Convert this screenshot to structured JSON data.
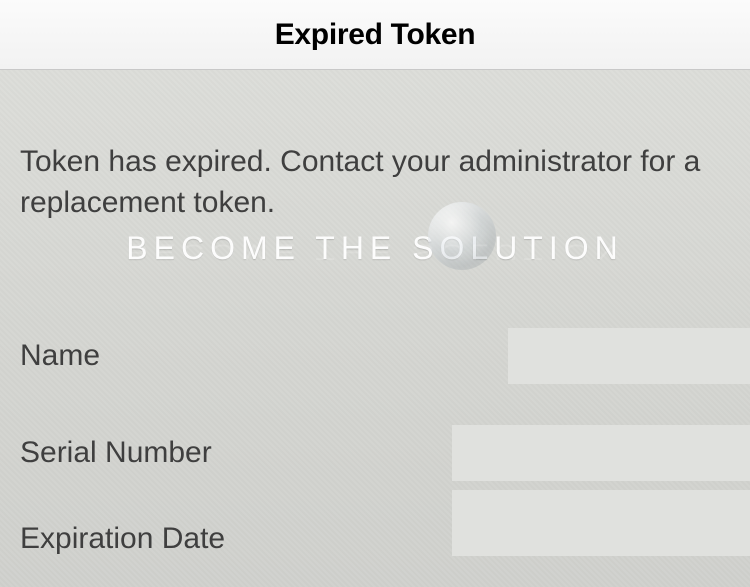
{
  "header": {
    "title": "Expired Token"
  },
  "message": "Token has expired. Contact your administrator for a replacement token.",
  "watermark": {
    "text": "BECOME THE SOLUTION"
  },
  "fields": {
    "name": {
      "label": "Name",
      "value": ""
    },
    "serial": {
      "label": "Serial Number",
      "value": ""
    },
    "expiration": {
      "label": "Expiration Date",
      "value": ""
    }
  }
}
